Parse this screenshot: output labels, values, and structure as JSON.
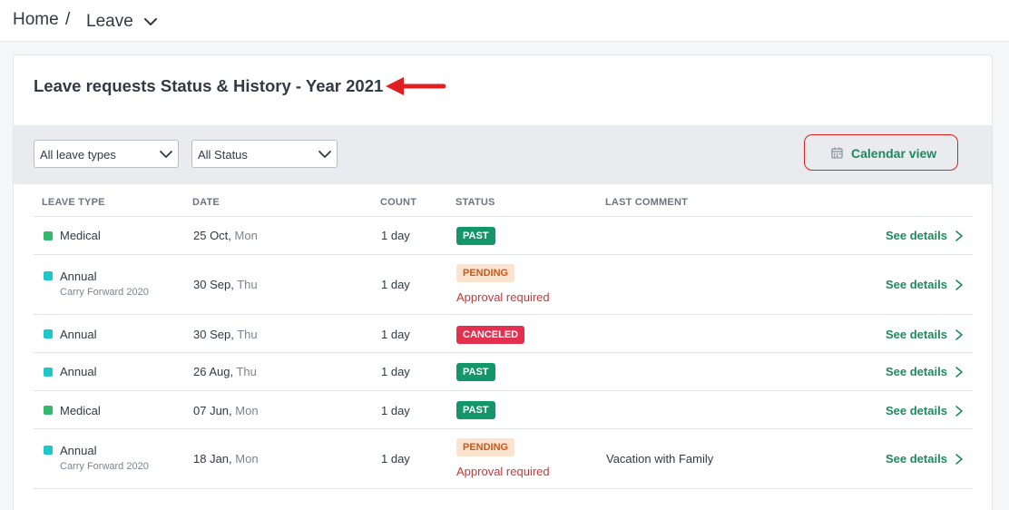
{
  "breadcrumb": {
    "home": "Home",
    "separator": "/",
    "current": "Leave"
  },
  "card": {
    "title": "Leave requests Status & History - Year 2021"
  },
  "filters": {
    "leave_type": "All leave types",
    "status": "All Status",
    "calendar_view": "Calendar view"
  },
  "columns": {
    "leave_type": "LEAVE TYPE",
    "date": "DATE",
    "count": "COUNT",
    "status": "STATUS",
    "last_comment": "LAST COMMENT"
  },
  "rows": [
    {
      "type": "Medical",
      "sub": "",
      "date": "25 Oct, ",
      "day": "Mon",
      "count": "1 day",
      "status": "PAST",
      "note": "",
      "comment": "",
      "action": "See details",
      "dot_color": "#34b86b"
    },
    {
      "type": "Annual",
      "sub": "Carry Forward 2020",
      "date": "30 Sep, ",
      "day": "Thu",
      "count": "1 day",
      "status": "PENDING",
      "note": "Approval required",
      "comment": "",
      "action": "See details",
      "dot_color": "#1ec8c8"
    },
    {
      "type": "Annual",
      "sub": "",
      "date": "30 Sep, ",
      "day": "Thu",
      "count": "1 day",
      "status": "CANCELED",
      "note": "",
      "comment": "",
      "action": "See details",
      "dot_color": "#1ec8c8"
    },
    {
      "type": "Annual",
      "sub": "",
      "date": "26 Aug, ",
      "day": "Thu",
      "count": "1 day",
      "status": "PAST",
      "note": "",
      "comment": "",
      "action": "See details",
      "dot_color": "#1ec8c8"
    },
    {
      "type": "Medical",
      "sub": "",
      "date": "07 Jun, ",
      "day": "Mon",
      "count": "1 day",
      "status": "PAST",
      "note": "",
      "comment": "",
      "action": "See details",
      "dot_color": "#34b86b"
    },
    {
      "type": "Annual",
      "sub": "Carry Forward 2020",
      "date": "18 Jan, ",
      "day": "Mon",
      "count": "1 day",
      "status": "PENDING",
      "note": "Approval required",
      "comment": "Vacation with Family",
      "action": "See details",
      "dot_color": "#1ec8c8"
    }
  ],
  "colors": {
    "accent_green": "#1e8a5e",
    "past_badge": "#14966b",
    "canceled_badge": "#e2314f",
    "pending_badge_bg": "#fbe3cf",
    "annotation_red": "#e02020"
  },
  "icons": {
    "breadcrumb_toggle": "chevron-down-icon",
    "calendar": "calendar-icon",
    "annotation": "red-arrow-icon",
    "row_action": "chevron-right-icon"
  }
}
